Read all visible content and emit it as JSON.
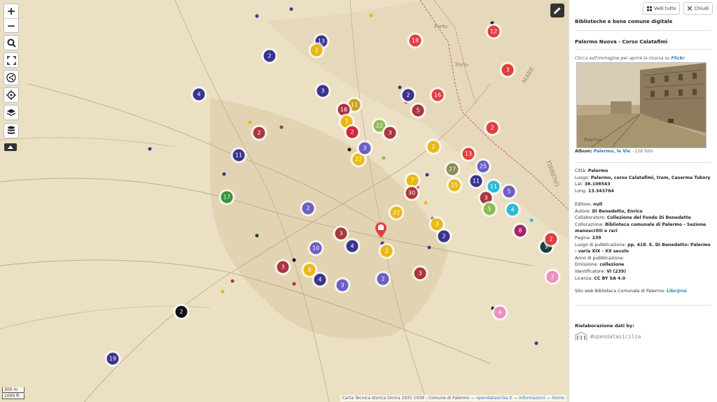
{
  "map_controls": {
    "zoom_in": "+",
    "zoom_out": "−"
  },
  "clusters": [
    {
      "label": "13",
      "color": "#3a3590"
    },
    {
      "label": "2",
      "color": "#e9b913"
    },
    {
      "label": "2",
      "color": "#3a3590"
    },
    {
      "label": "3",
      "color": "#3a3590"
    },
    {
      "label": "4",
      "color": "#3a3590"
    },
    {
      "label": "11",
      "color": "#c9a21c"
    },
    {
      "label": "18",
      "color": "#a93640"
    },
    {
      "label": "7",
      "color": "#e9b913"
    },
    {
      "label": "2",
      "color": "#d0263b"
    },
    {
      "label": "22",
      "color": "#8cbc52"
    },
    {
      "label": "3",
      "color": "#a93640"
    },
    {
      "label": "2",
      "color": "#a93640"
    },
    {
      "label": "5",
      "color": "#a93640"
    },
    {
      "label": "2",
      "color": "#3a3590"
    },
    {
      "label": "16",
      "color": "#e23e3e"
    },
    {
      "label": "18",
      "color": "#e23e3e"
    },
    {
      "label": "12",
      "color": "#e23e3e"
    },
    {
      "label": "3",
      "color": "#e23e3e"
    },
    {
      "label": "2",
      "color": "#e23e3e"
    },
    {
      "label": "2",
      "color": "#e9b913"
    },
    {
      "label": "11",
      "color": "#3a3590"
    },
    {
      "label": "22",
      "color": "#e9b913"
    },
    {
      "label": "3",
      "color": "#6b5fc4"
    },
    {
      "label": "17",
      "color": "#39943d"
    },
    {
      "label": "13",
      "color": "#e23e3e"
    },
    {
      "label": "27",
      "color": "#8a8a5a"
    },
    {
      "label": "25",
      "color": "#6b5fc4"
    },
    {
      "label": "7",
      "color": "#e9b913"
    },
    {
      "label": "30",
      "color": "#a93640"
    },
    {
      "label": "15",
      "color": "#e9b913"
    },
    {
      "label": "11",
      "color": "#3a3590"
    },
    {
      "label": "11",
      "color": "#2bbbd8"
    },
    {
      "label": "5",
      "color": "#6b5fc4"
    },
    {
      "label": "3",
      "color": "#a93640"
    },
    {
      "label": "5",
      "color": "#8cbc52"
    },
    {
      "label": "4",
      "color": "#2bbbd8"
    },
    {
      "label": "2",
      "color": "#6b5fc4"
    },
    {
      "label": "22",
      "color": "#e9b913"
    },
    {
      "label": "3",
      "color": "#e9b913"
    },
    {
      "label": "2",
      "color": "#3a3590"
    },
    {
      "label": "8",
      "color": "#a5236a"
    },
    {
      "label": "3",
      "color": "#a93640"
    },
    {
      "label": "4",
      "color": "#3a3590"
    },
    {
      "label": "2",
      "color": "#e9b913"
    },
    {
      "label": "10",
      "color": "#6b5fc4"
    },
    {
      "label": "3",
      "color": "#a93640"
    },
    {
      "label": "8",
      "color": "#e9b913"
    },
    {
      "label": "4",
      "color": "#3a3590"
    },
    {
      "label": "3",
      "color": "#6b5fc4"
    },
    {
      "label": "2",
      "color": "#6b5fc4"
    },
    {
      "label": "3",
      "color": "#a93640"
    },
    {
      "label": "3",
      "color": "#1e3f3a"
    },
    {
      "label": "2",
      "color": "#e23e3e"
    },
    {
      "label": "2",
      "color": "#ec8fc0"
    },
    {
      "label": "4",
      "color": "#ec8fc0"
    },
    {
      "label": "2",
      "color": "#111111"
    },
    {
      "label": "19",
      "color": "#3a3590"
    }
  ],
  "scale": {
    "metric": "300 m",
    "imperial": "1000 ft"
  },
  "attribution": {
    "text": "Carta Tecnica storica Omira 1935 1939 - Comune di Palermo —",
    "link1": "opendatasicilia.it",
    "sep": "—",
    "link2": "Informazioni",
    "link3": "Home"
  },
  "panel": {
    "btn_view_all": "Vedi tutto",
    "btn_close": "Chiudi",
    "title": "Biblioteche e bene comune digitale",
    "subtitle": "Palermo Nuova - Corso Calatafimi",
    "hint": "Clicca sull'immagine per aprire la risorsa su",
    "hint_link": "Flickr",
    "album_label": "Album:",
    "album_link": "Palermo, le Vie",
    "album_count": "- 116 foto",
    "fields_1": [
      {
        "k": "Città:",
        "v": "Palermo"
      },
      {
        "k": "Luogo:",
        "v": "Palermo, corso Calatafimi, tram, Caserma Tukory"
      },
      {
        "k": "Lat:",
        "v": "38.108543"
      },
      {
        "k": "Long:",
        "v": "13.343764"
      }
    ],
    "fields_2": [
      {
        "k": "Editore:",
        "v": "null"
      },
      {
        "k": "Autore:",
        "v": "Di Benedetto, Enrico"
      },
      {
        "k": "Collaboratore:",
        "v": "Collezione del Fondo Di Benedetto"
      },
      {
        "k": "Collocazione:",
        "v": "Biblioteca comunale di Palermo - Sezione manoscritti e rari"
      },
      {
        "k": "Pagina:",
        "v": "239"
      },
      {
        "k": "Luogo di pubblicazione:",
        "v": "pp. 418. E. Di Benedetto: Palermo - varia XIX - XX secolo"
      },
      {
        "k": "Anno di pubblicazione:",
        "v": ""
      },
      {
        "k": "Emissione:",
        "v": "collezione"
      },
      {
        "k": "Identificatore:",
        "v": "VI (239)"
      },
      {
        "k": "Licenza:",
        "v": "CC BY SA 4.0"
      }
    ],
    "site_label": "Sito web Biblioteca Comunale di Palermo:",
    "site_link": "Libr@rsi",
    "rie_title": "Rielaborazione dati by:",
    "logo_text": "#opendatasicilia"
  }
}
